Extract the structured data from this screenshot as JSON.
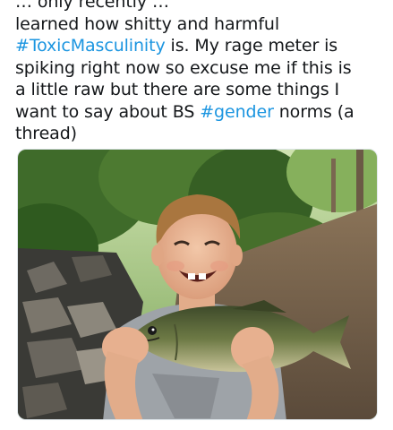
{
  "tweet": {
    "line0": "… only recently …",
    "line1": "learned how shitty and harmful",
    "hashtag_toxic": "#ToxicMasculinity",
    "line2_rest": " is. My rage meter is",
    "line3": "spiking right now so excuse me if this is",
    "line4": "a little raw but there are some things I",
    "line5_pre": "want to say about BS ",
    "hashtag_gender": "#gender",
    "line5_post": " norms (a",
    "line6": "thread)"
  },
  "colors": {
    "text": "#14171a",
    "link": "#1b95e0",
    "border": "#e1e8ed"
  }
}
